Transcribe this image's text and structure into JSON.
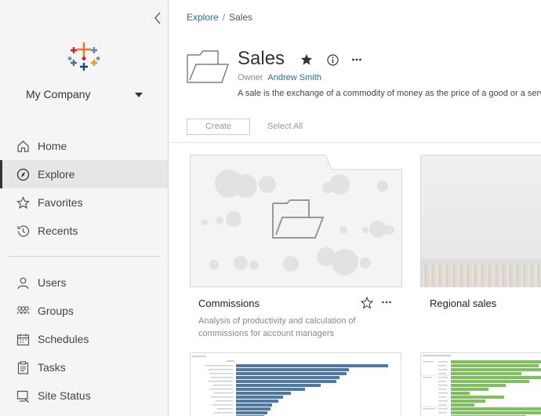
{
  "sidebar": {
    "company_name": "My Company",
    "nav_main": [
      {
        "label": "Home",
        "icon": "home-icon"
      },
      {
        "label": "Explore",
        "icon": "compass-icon",
        "active": true
      },
      {
        "label": "Favorites",
        "icon": "star-icon"
      },
      {
        "label": "Recents",
        "icon": "clock-icon"
      }
    ],
    "nav_admin": [
      {
        "label": "Users",
        "icon": "user-icon"
      },
      {
        "label": "Groups",
        "icon": "group-icon"
      },
      {
        "label": "Schedules",
        "icon": "calendar-icon"
      },
      {
        "label": "Tasks",
        "icon": "clipboard-icon"
      },
      {
        "label": "Site Status",
        "icon": "monitor-icon"
      }
    ]
  },
  "breadcrumb": {
    "root": "Explore",
    "separator": "/",
    "current": "Sales"
  },
  "project": {
    "title": "Sales",
    "owner_label": "Owner",
    "owner_name": "Andrew Smith",
    "description": "A sale is the exchange of a commodity of money as the price of a good or a service"
  },
  "toolbar": {
    "create_label": "Create",
    "select_all_label": "Select All"
  },
  "cards": [
    {
      "title": "Commissions",
      "description_line1": "Analysis of productivity and calculation of",
      "description_line2": "commissions for account managers"
    },
    {
      "title": "Regional sales"
    }
  ],
  "colors": {
    "accent_link": "#1f6e9e",
    "sidebar_bg": "#f5f5f5",
    "active_bg": "#e6e6e6",
    "bar_blue": "#4e79a7",
    "bar_green": "#7fbf5e"
  }
}
